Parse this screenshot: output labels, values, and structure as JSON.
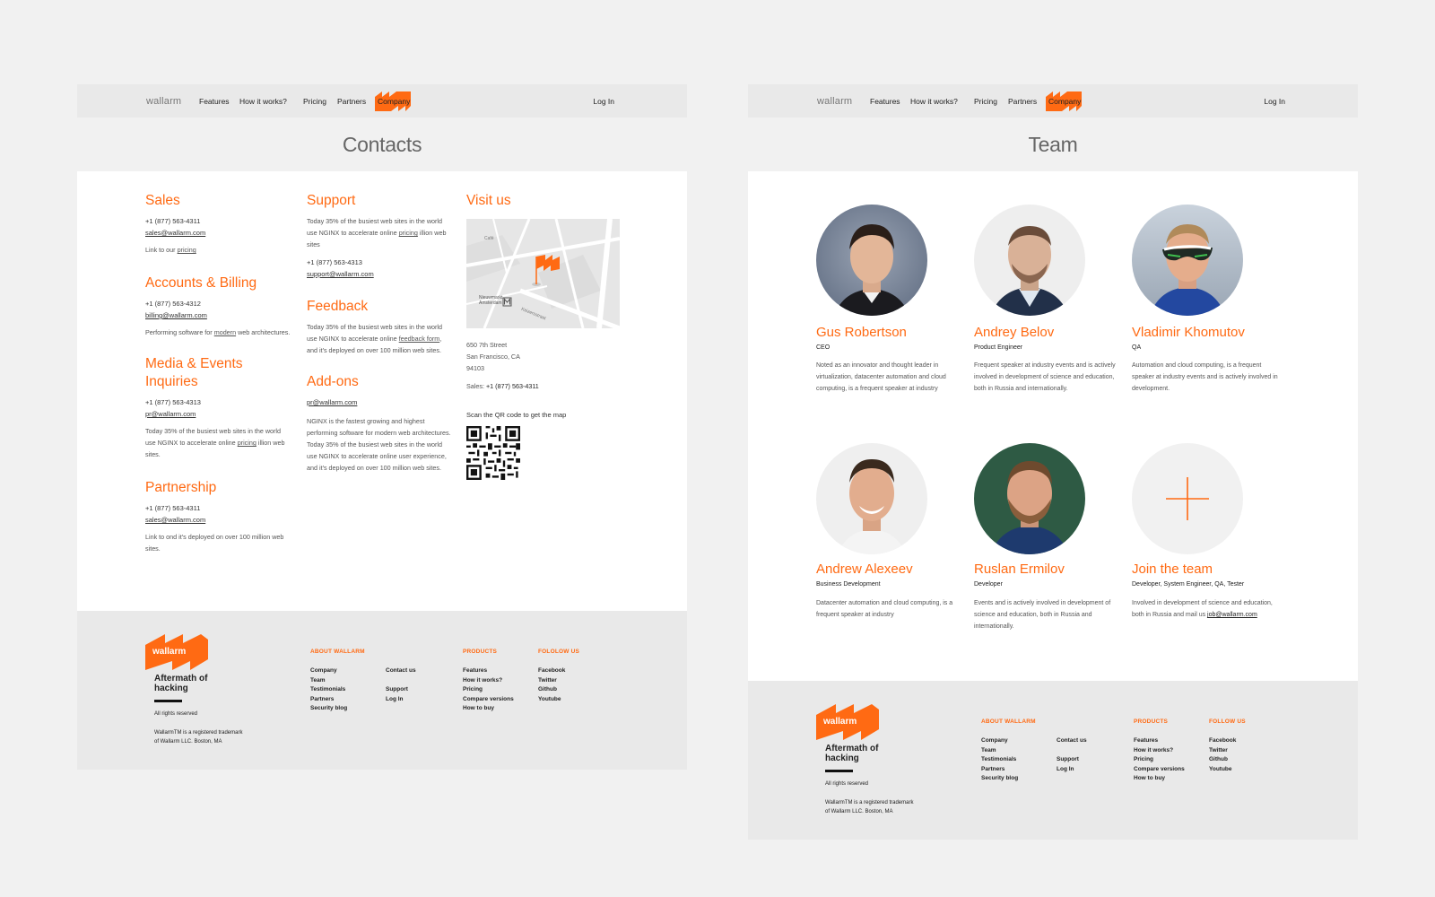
{
  "brand": {
    "logo_text": "wallarm",
    "accent_color": "#ff6a13",
    "tagline": "Aftermath of hacking",
    "rights": "All rights reserved",
    "trademark_line1": "WallarmTM is a registered trademark",
    "trademark_line2": "of Wallarm LLC. Boston, MA"
  },
  "nav": {
    "items": [
      "Features",
      "How it works?",
      "Pricing",
      "Partners",
      "Company"
    ],
    "login": "Log In"
  },
  "contacts": {
    "title": "Contacts",
    "sales": {
      "heading": "Sales",
      "phone": "+1 (877) 563-4311",
      "email": "sales@wallarm.com",
      "text_prefix": "Link to our ",
      "text_link": "pricing"
    },
    "billing": {
      "heading": "Accounts & Billing",
      "phone": "+1 (877) 563-4312",
      "email": "billing@wallarm.com",
      "text_prefix": "Performing software for ",
      "text_link": "modern",
      "text_suffix": " web architectures."
    },
    "media": {
      "heading_line1": "Media & Events",
      "heading_line2": "Inquiries",
      "phone": "+1 (877) 563-4313",
      "email": "pr@wallarm.com",
      "text_line1": "Today 35% of the busiest web sites in the world",
      "text_line2_prefix": "use NGINX to accelerate online ",
      "text_line2_link": "pricing",
      "text_line2_suffix": " illion web",
      "text_line3": "sites."
    },
    "partnership": {
      "heading": "Partnership",
      "phone": "+1 (877) 563-4311",
      "email": "sales@wallarm.com",
      "text_line1": "Link to ond it's deployed on over 100 million web",
      "text_line2": "sites."
    },
    "support": {
      "heading": "Support",
      "text_line1": "Today 35% of the busiest web sites in the world",
      "text_line2_prefix": "use NGINX to accelerate online ",
      "text_line2_link": "pricing",
      "text_line2_suffix": " illion web",
      "text_line3": "sites",
      "phone": "+1 (877) 563-4313",
      "email": "support@wallarm.com"
    },
    "feedback": {
      "heading": "Feedback",
      "text_line1": "Today 35% of the busiest web sites in the world",
      "text_line2_prefix": "use NGINX to accelerate online ",
      "text_line2_link": "feedback form",
      "text_line2_suffix": ",",
      "text_line3": "and it's deployed on over 100 million web sites."
    },
    "addons": {
      "heading": "Add-ons",
      "email": "pr@wallarm.com",
      "text_line1": "NGINX is the fastest growing and highest",
      "text_line2": "performing software for modern web architectures.",
      "text_line3": "Today 35% of the busiest web sites in the world",
      "text_line4": "use NGINX to accelerate online user experience,",
      "text_line5": "and it's deployed on over 100 million web sites."
    },
    "visit": {
      "heading": "Visit us",
      "address_line1": "650 7th Street",
      "address_line2": "San Francisco, CA",
      "address_line3": "94103",
      "sales_label": "Sales: ",
      "sales_phone": "+1 (877) 563-4311",
      "qr_caption": "Scan the QR code to get the map"
    },
    "map_labels": {
      "cafe": "Café",
      "nieuwmarkt": "Nieuwmarkt",
      "amsterdam": "Amsterdam",
      "street": "Keizersstraat"
    }
  },
  "team": {
    "title": "Team",
    "members": [
      {
        "name": "Gus Robertson",
        "role": "CEO",
        "desc": "Noted as an innovator and thought leader in virtualization, datacenter automation and cloud computing, is a frequent speaker at industry"
      },
      {
        "name": "Andrey Belov",
        "role": "Product Engineer",
        "desc": "Frequent speaker at industry events and is actively involved in development of science and education, both in Russia and internationally."
      },
      {
        "name": "Vladimir Khomutov",
        "role": "QA",
        "desc": "Automation and cloud computing, is a frequent speaker at industry events and is actively involved in development."
      },
      {
        "name": "Andrew Alexeev",
        "role": "Business Development",
        "desc": "Datacenter automation and cloud computing, is a frequent speaker at industry"
      },
      {
        "name": "Ruslan Ermilov",
        "role": "Developer",
        "desc": "Events and is actively involved in development of science and education, both in Russia and internationally."
      }
    ],
    "join": {
      "name": "Join the team",
      "role": "Developer, System Engineer, QA, Tester",
      "desc_prefix": "Involved in development of science and education, both in Russia and mail us ",
      "email": "job@wallarm.com"
    }
  },
  "footer": {
    "about_heading": "ABOUT WALLARM",
    "about_col1": [
      "Company",
      "Team",
      "Testimonials",
      "Partners",
      "Security blog"
    ],
    "about_col2": [
      "Contact us",
      "",
      "Support",
      "Log In"
    ],
    "products_heading": "PRODUCTS",
    "products": [
      "Features",
      "How it works?",
      "Pricing",
      "Compare versions",
      "How to buy"
    ],
    "follow_heading_contacts": "FOLOLOW US",
    "follow_heading_team": "FOLLOW US",
    "follow": [
      "Facebook",
      "Twitter",
      "Github",
      "Youtube"
    ]
  }
}
